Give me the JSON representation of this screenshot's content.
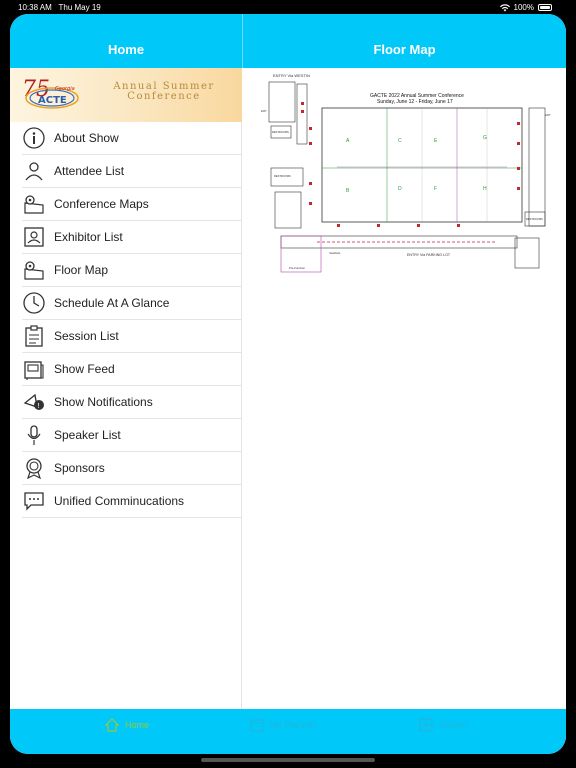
{
  "status_bar": {
    "time": "10:38 AM",
    "date": "Thu May 19",
    "battery": "100%",
    "battery_level": 1.0
  },
  "nav": {
    "left_title": "Home",
    "right_title": "Floor Map"
  },
  "banner": {
    "logo_number": "75",
    "logo_state": "Georgia",
    "logo_org": "ACTE",
    "line1": "Annual Summer",
    "line2": "Conference"
  },
  "menu": {
    "items": [
      {
        "label": "About Show",
        "icon": "info-icon"
      },
      {
        "label": "Attendee List",
        "icon": "person-icon"
      },
      {
        "label": "Conference Maps",
        "icon": "map-pin-icon"
      },
      {
        "label": "Exhibitor List",
        "icon": "exhibitor-icon"
      },
      {
        "label": "Floor Map",
        "icon": "map-pin-icon"
      },
      {
        "label": "Schedule At A Glance",
        "icon": "clock-icon"
      },
      {
        "label": "Session List",
        "icon": "clipboard-icon"
      },
      {
        "label": "Show Feed",
        "icon": "feed-icon"
      },
      {
        "label": "Show Notifications",
        "icon": "bell-icon"
      },
      {
        "label": "Speaker List",
        "icon": "microphone-icon"
      },
      {
        "label": "Sponsors",
        "icon": "award-icon"
      },
      {
        "label": "Unified Comminucations",
        "icon": "chat-icon"
      }
    ]
  },
  "floor_map": {
    "title": "GACTE 2022 Annual Summer Conference",
    "dates": "Sunday, June 12 - Friday, June 17",
    "entry_top": "ENTRY Via WESTIN",
    "entry_bottom": "ENTRY Via PARKING LOT",
    "booths_top": [
      "A",
      "C",
      "E",
      "G"
    ],
    "booths_bottom": [
      "B",
      "D",
      "F",
      "H"
    ],
    "restrooms_label": "RESTROOMS",
    "exit_label": "EXIT",
    "vestibule_label": "Vestibule",
    "pre_function_label": "Pre-Function"
  },
  "tabbar": {
    "home": "Home",
    "my_planner": "My Planner",
    "search": "Search"
  },
  "colors": {
    "nav": "#00c8f8",
    "tab_active": "#9ac934",
    "booth_text": "#2a9d3b"
  }
}
